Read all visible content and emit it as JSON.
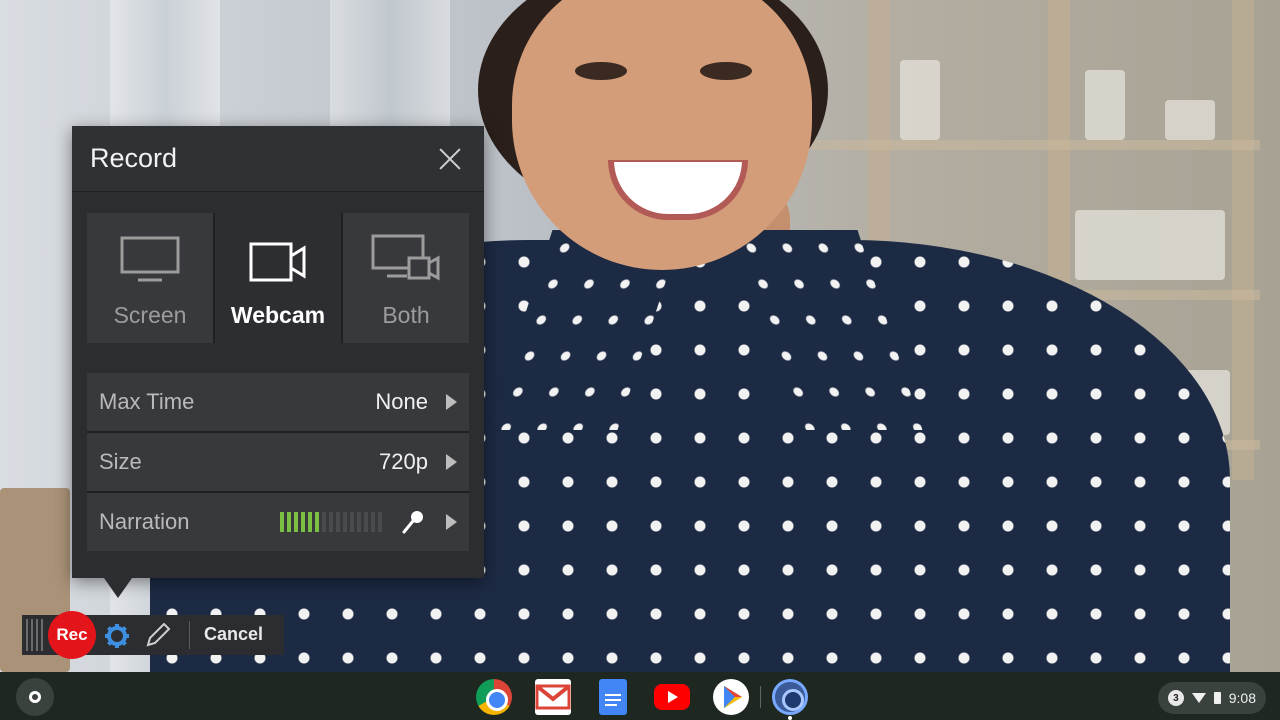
{
  "dialog": {
    "title": "Record",
    "modes": [
      {
        "label": "Screen",
        "icon": "monitor-icon",
        "active": false
      },
      {
        "label": "Webcam",
        "icon": "camera-icon",
        "active": true
      },
      {
        "label": "Both",
        "icon": "monitor-camera-icon",
        "active": false
      }
    ],
    "settings": [
      {
        "label": "Max Time",
        "value": "None"
      },
      {
        "label": "Size",
        "value": "720p"
      },
      {
        "label": "Narration",
        "value": "",
        "meter_level": 0.4
      }
    ]
  },
  "toolbar": {
    "rec_label": "Rec",
    "cancel_label": "Cancel",
    "rec_color": "#e3151b",
    "gear_color": "#3d8fe0"
  },
  "shelf": {
    "apps": [
      "chrome-icon",
      "gmail-icon",
      "docs-icon",
      "youtube-icon",
      "play-store-icon",
      "screencast-app-icon"
    ],
    "tray": {
      "notification_count": "3",
      "time": "9:08"
    }
  }
}
